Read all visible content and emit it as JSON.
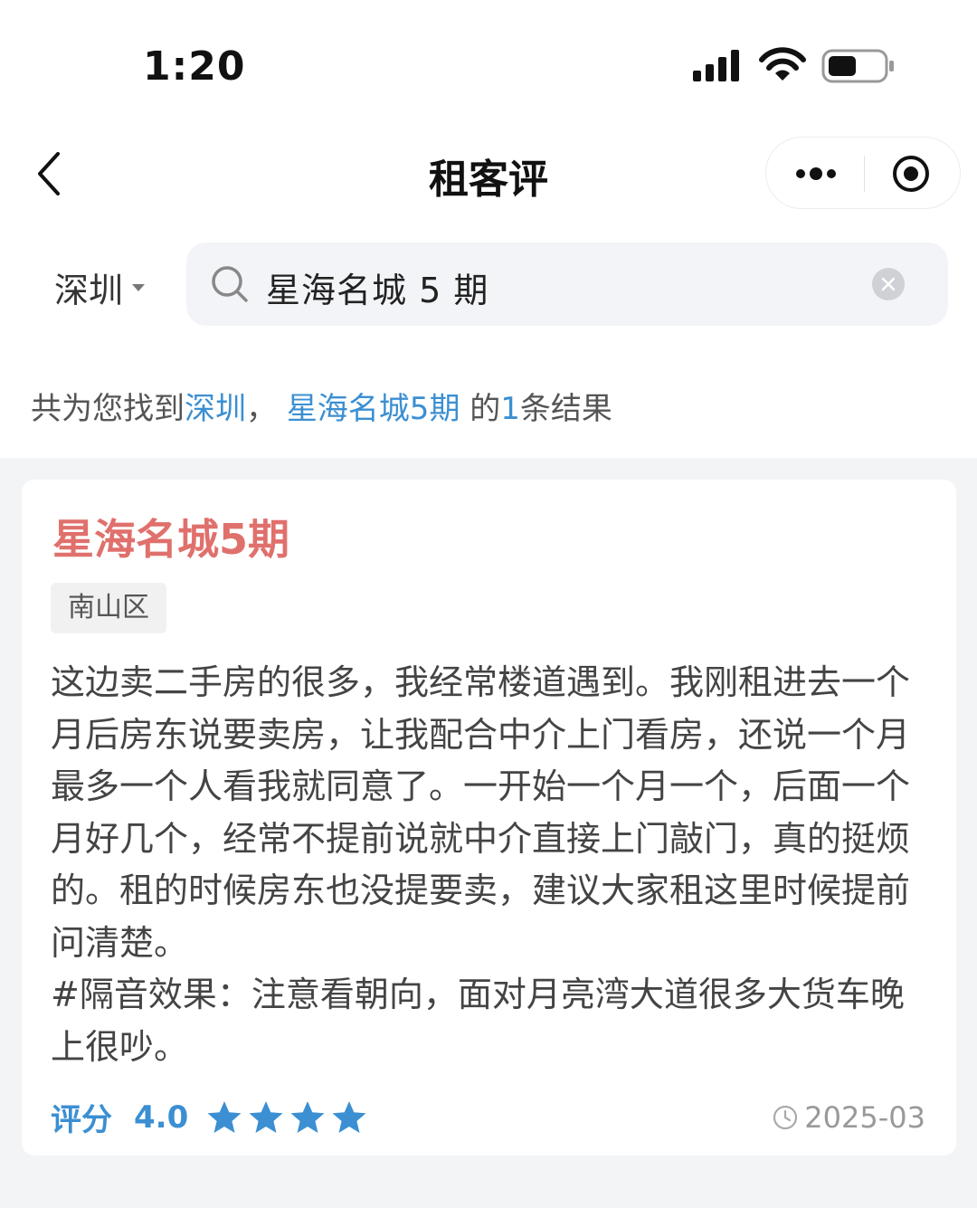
{
  "status_bar": {
    "time": "1:20",
    "icons": [
      "signal-icon",
      "wifi-icon",
      "battery-icon"
    ]
  },
  "nav": {
    "title": "租客评",
    "icons": [
      "back-icon",
      "more-icon",
      "target-icon"
    ]
  },
  "search": {
    "city": "深圳",
    "query": "星海名城 5 期",
    "icons": [
      "search-icon",
      "clear-icon"
    ]
  },
  "summary": {
    "prefix": "共为您找到",
    "city": "深圳",
    "sep": "，",
    "keyword": "星海名城5期",
    "mid": "的",
    "count": "1",
    "suffix": "条结果"
  },
  "result": {
    "title": "星海名城5期",
    "district": "南山区",
    "review": "这边卖二手房的很多，我经常楼道遇到。我刚租进去一个月后房东说要卖房，让我配合中介上门看房，还说一个月最多一个人看我就同意了。一开始一个月一个，后面一个月好几个，经常不提前说就中介直接上门敲门，真的挺烦的。租的时候房东也没提要卖，建议大家租这里时候提前问清楚。",
    "note": "#隔音效果：注意看朝向，面对月亮湾大道很多大货车晚上很吵。",
    "rating_label": "评分",
    "rating_value": "4.0",
    "stars": 4,
    "date": "2025-03"
  },
  "colors": {
    "accent_blue": "#3b8fd2",
    "title_red": "#e0706c",
    "background": "#f3f4f6"
  }
}
